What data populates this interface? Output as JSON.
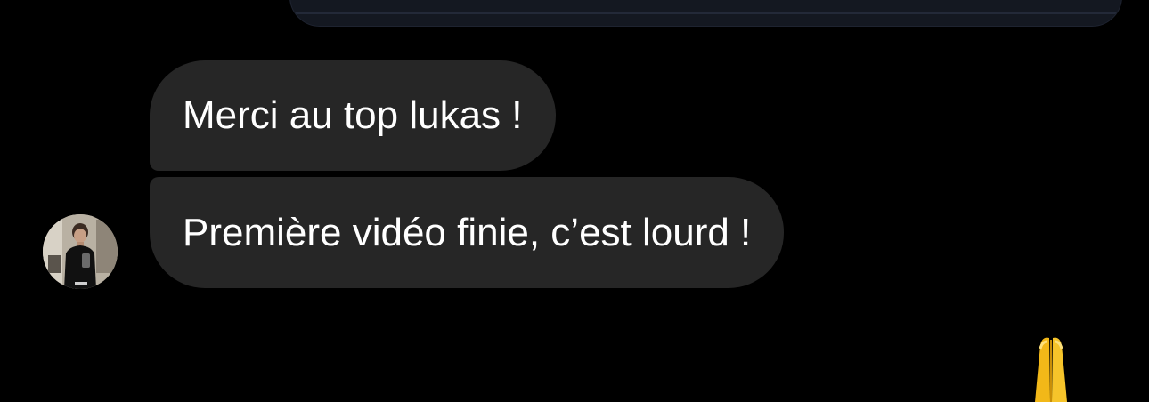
{
  "thread": {
    "messages": [
      {
        "text": "Merci au top lukas !",
        "direction": "incoming"
      },
      {
        "text": "Première vidéo finie, c’est lourd !",
        "direction": "incoming"
      }
    ],
    "sender_avatar_icon": "user-avatar-photo",
    "partial_reaction_icon": "folded-hands-emoji"
  },
  "colors": {
    "background": "#000000",
    "incoming_bubble": "#262626",
    "text": "#ffffff",
    "sent_card": "#141821"
  }
}
